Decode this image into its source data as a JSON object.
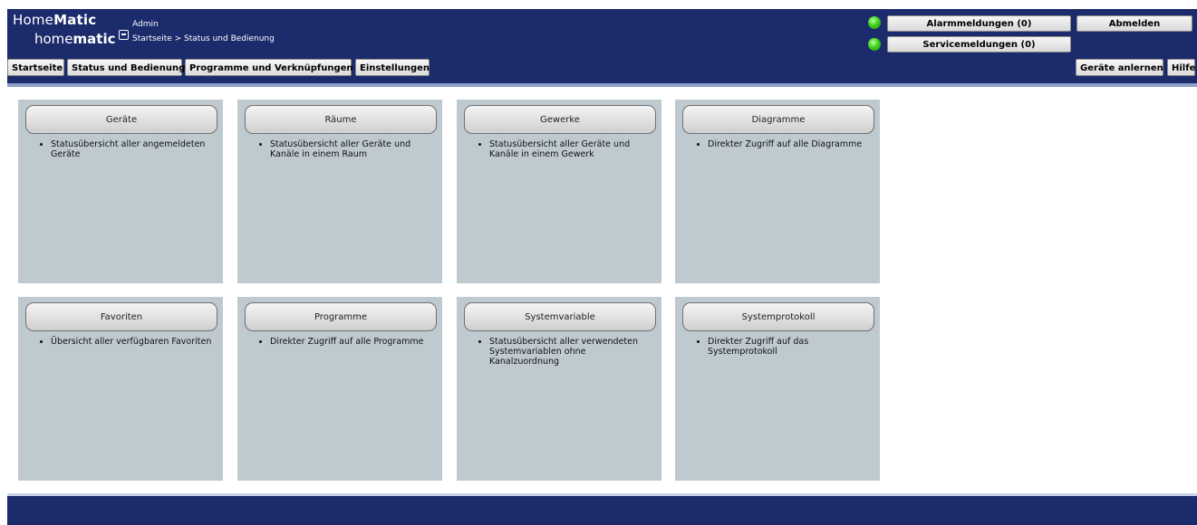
{
  "header": {
    "logo_top_light": "Home",
    "logo_top_bold": "Matic",
    "logo_bottom_light": "home",
    "logo_bottom_bold": "matic",
    "user": "Admin",
    "breadcrumb": "Startseite > Status und Bedienung",
    "alarm_label": "Alarmmeldungen (0)",
    "service_label": "Servicemeldungen (0)",
    "logout_label": "Abmelden",
    "status_led_color": "#3fd11d"
  },
  "nav": {
    "home": "Startseite",
    "status": "Status und Bedienung",
    "programs": "Programme und Verknüpfungen",
    "settings": "Einstellungen",
    "teach_devices": "Geräte anlernen",
    "help": "Hilfe"
  },
  "tiles": [
    {
      "title": "Geräte",
      "desc": "Statusübersicht aller angemeldeten Geräte"
    },
    {
      "title": "Räume",
      "desc": "Statusübersicht aller Geräte und Kanäle in einem Raum"
    },
    {
      "title": "Gewerke",
      "desc": "Statusübersicht aller Geräte und Kanäle in einem Gewerk"
    },
    {
      "title": "Diagramme",
      "desc": "Direkter Zugriff auf alle Diagramme"
    },
    {
      "title": "Favoriten",
      "desc": "Übersicht aller verfügbaren Favoriten"
    },
    {
      "title": "Programme",
      "desc": "Direkter Zugriff auf alle Programme"
    },
    {
      "title": "Systemvariable",
      "desc": "Statusübersicht aller verwendeten Systemvariablen ohne Kanalzuordnung"
    },
    {
      "title": "Systemprotokoll",
      "desc": "Direkter Zugriff auf das Systemprotokoll"
    }
  ],
  "colors": {
    "header_bg": "#1b2b6b",
    "tile_bg": "#bfcad0"
  }
}
